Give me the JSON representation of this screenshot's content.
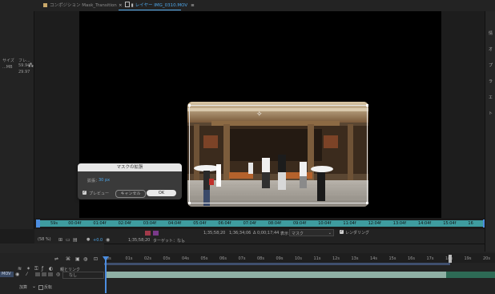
{
  "tabs": {
    "comp_tab": "コンポジション Mask_Transition",
    "layer_tab": "レイヤー IMG_0310.MOV",
    "comp_tab_icon": "composition-icon",
    "layer_lock_icon": "lock-icon"
  },
  "project_panel": {
    "col_size": "サイズ",
    "col_fps": "フレ...",
    "rows": [
      {
        "name": "...MB",
        "fps": "59.94"
      },
      {
        "name": "",
        "fps": "29.97"
      }
    ]
  },
  "right_panel": {
    "letters": [
      "情",
      "オ",
      "プ",
      "ラ",
      "エ",
      "ト"
    ]
  },
  "dialog": {
    "title": "マスクの拡張",
    "field_label": "拡張：",
    "field_value": "30 px",
    "preview_label": "プレビュー",
    "cancel_label": "キャンセル",
    "ok_label": "OK"
  },
  "ruler": {
    "ticks": [
      "59s",
      "00:04f",
      "01:04f",
      "02:04f",
      "03:04f",
      "04:04f",
      "05:04f",
      "06:04f",
      "07:04f",
      "08:04f",
      "09:04f",
      "10:04f",
      "11:04f",
      "12:04f",
      "13:04f",
      "14:04f",
      "15:04f",
      "16"
    ]
  },
  "viewer_footer": {
    "zoom": "(58 %)",
    "timecode": "1;35;58;20",
    "timecode_right": "0;35;58;20",
    "target_label": "ターゲット：なし",
    "tc1": "1;35;58;20",
    "tc2": "1;36;34;06",
    "tc3": "Δ 0;00;17;44",
    "view_label": "表示：",
    "view_value": "マスク",
    "render_label": "レンダリング",
    "zoom2": "(58 %)",
    "exposure": "+0.0"
  },
  "timeline": {
    "ticks": [
      "0s",
      "01s",
      "02s",
      "03s",
      "04s",
      "05s",
      "06s",
      "07s",
      "08s",
      "09s",
      "10s",
      "11s",
      "12s",
      "13s",
      "14s",
      "15s",
      "16s",
      "17s",
      "18s",
      "19s",
      "20s"
    ],
    "parent_header": "親とリンク",
    "parent_value": "なし",
    "mode_label": "加算",
    "invert_label": "反転",
    "layer_name": "MOV"
  },
  "colors": {
    "accent": "#4ea6e8",
    "ruler_bar": "#3e9c9f",
    "track": "#8fb0a5",
    "playhead": "#4c8de0"
  }
}
